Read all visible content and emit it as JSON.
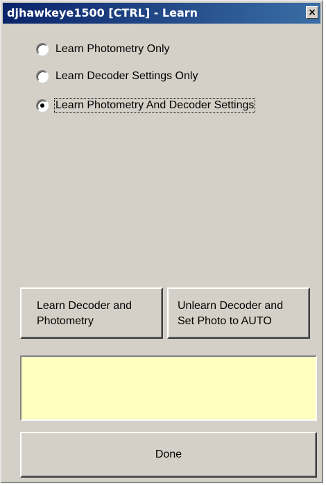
{
  "window": {
    "title": "djhawkeye1500 [CTRL] - Learn",
    "close_glyph": "×"
  },
  "options": [
    {
      "label": "Learn Photometry Only",
      "selected": false
    },
    {
      "label": "Learn Decoder Settings Only",
      "selected": false
    },
    {
      "label": "Learn Photometry And Decoder Settings",
      "selected": true
    }
  ],
  "buttons": {
    "learn": "Learn Decoder and\nPhotometry",
    "unlearn": "Unlearn Decoder and\nSet Photo to AUTO",
    "done": "Done"
  },
  "status": {
    "text": ""
  },
  "colors": {
    "title_bar": "#0a246a",
    "window_bg": "#d4d0c8",
    "status_bg": "#ffffc0"
  }
}
